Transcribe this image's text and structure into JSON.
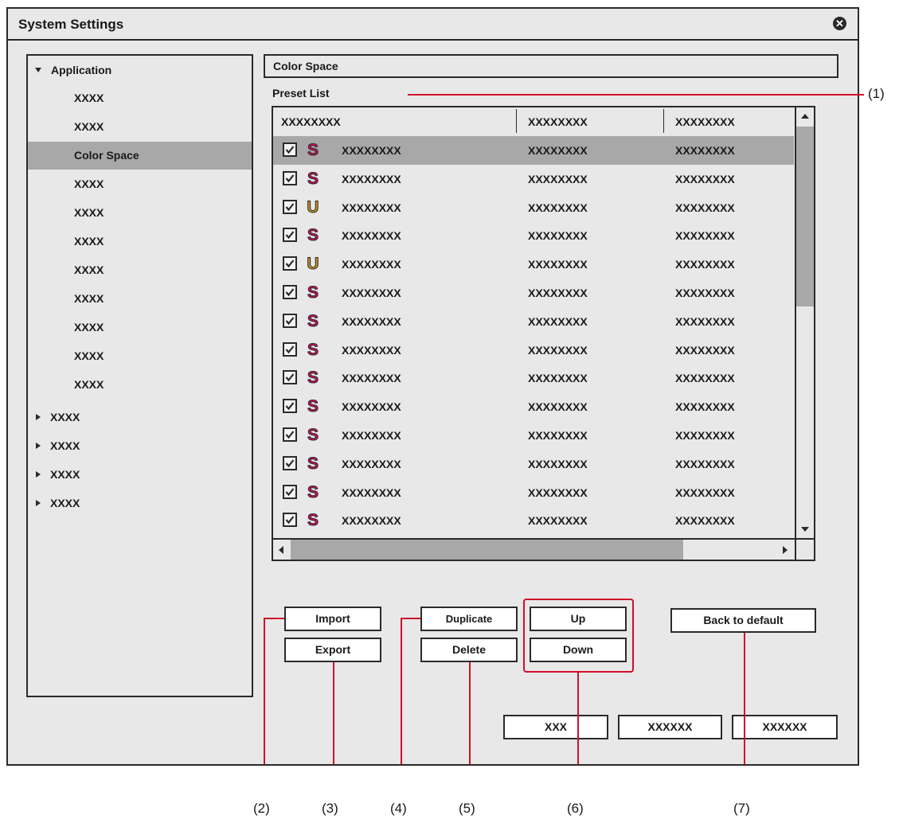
{
  "window": {
    "title": "System Settings",
    "close_icon": "close-circle-icon"
  },
  "tree": {
    "root_label": "Application",
    "children": [
      "XXXX",
      "XXXX",
      "Color Space",
      "XXXX",
      "XXXX",
      "XXXX",
      "XXXX",
      "XXXX",
      "XXXX",
      "XXXX",
      "XXXX"
    ],
    "selected_index": 2,
    "collapsed": [
      "XXXX",
      "XXXX",
      "XXXX",
      "XXXX"
    ]
  },
  "section": {
    "title": "Color Space",
    "preset_list_label": "Preset List"
  },
  "list": {
    "headers": [
      "XXXXXXXX",
      "XXXXXXXX",
      "XXXXXXXX"
    ],
    "rows": [
      {
        "checked": true,
        "type": "S",
        "c1": "XXXXXXXX",
        "c2": "XXXXXXXX",
        "c3": "XXXXXXXX",
        "selected": true
      },
      {
        "checked": true,
        "type": "S",
        "c1": "XXXXXXXX",
        "c2": "XXXXXXXX",
        "c3": "XXXXXXXX"
      },
      {
        "checked": true,
        "type": "U",
        "c1": "XXXXXXXX",
        "c2": "XXXXXXXX",
        "c3": "XXXXXXXX"
      },
      {
        "checked": true,
        "type": "S",
        "c1": "XXXXXXXX",
        "c2": "XXXXXXXX",
        "c3": "XXXXXXXX"
      },
      {
        "checked": true,
        "type": "U",
        "c1": "XXXXXXXX",
        "c2": "XXXXXXXX",
        "c3": "XXXXXXXX"
      },
      {
        "checked": true,
        "type": "S",
        "c1": "XXXXXXXX",
        "c2": "XXXXXXXX",
        "c3": "XXXXXXXX"
      },
      {
        "checked": true,
        "type": "S",
        "c1": "XXXXXXXX",
        "c2": "XXXXXXXX",
        "c3": "XXXXXXXX"
      },
      {
        "checked": true,
        "type": "S",
        "c1": "XXXXXXXX",
        "c2": "XXXXXXXX",
        "c3": "XXXXXXXX"
      },
      {
        "checked": true,
        "type": "S",
        "c1": "XXXXXXXX",
        "c2": "XXXXXXXX",
        "c3": "XXXXXXXX"
      },
      {
        "checked": true,
        "type": "S",
        "c1": "XXXXXXXX",
        "c2": "XXXXXXXX",
        "c3": "XXXXXXXX"
      },
      {
        "checked": true,
        "type": "S",
        "c1": "XXXXXXXX",
        "c2": "XXXXXXXX",
        "c3": "XXXXXXXX"
      },
      {
        "checked": true,
        "type": "S",
        "c1": "XXXXXXXX",
        "c2": "XXXXXXXX",
        "c3": "XXXXXXXX"
      },
      {
        "checked": true,
        "type": "S",
        "c1": "XXXXXXXX",
        "c2": "XXXXXXXX",
        "c3": "XXXXXXXX"
      },
      {
        "checked": true,
        "type": "S",
        "c1": "XXXXXXXX",
        "c2": "XXXXXXXX",
        "c3": "XXXXXXXX"
      }
    ]
  },
  "buttons": {
    "import": "Import",
    "export": "Export",
    "duplicate": "Duplicate",
    "delete": "Delete",
    "up": "Up",
    "down": "Down",
    "back_to_default": "Back to default",
    "footer": [
      "XXX",
      "XXXXXX",
      "XXXXXX"
    ]
  },
  "callouts": {
    "c1": "(1)",
    "c2": "(2)",
    "c3": "(3)",
    "c4": "(4)",
    "c5": "(5)",
    "c6": "(6)",
    "c7": "(7)"
  },
  "colors": {
    "accent_red": "#d0102a",
    "badge_s": "#c8105c",
    "badge_u": "#c8901c",
    "selection": "#a8a8a8"
  }
}
